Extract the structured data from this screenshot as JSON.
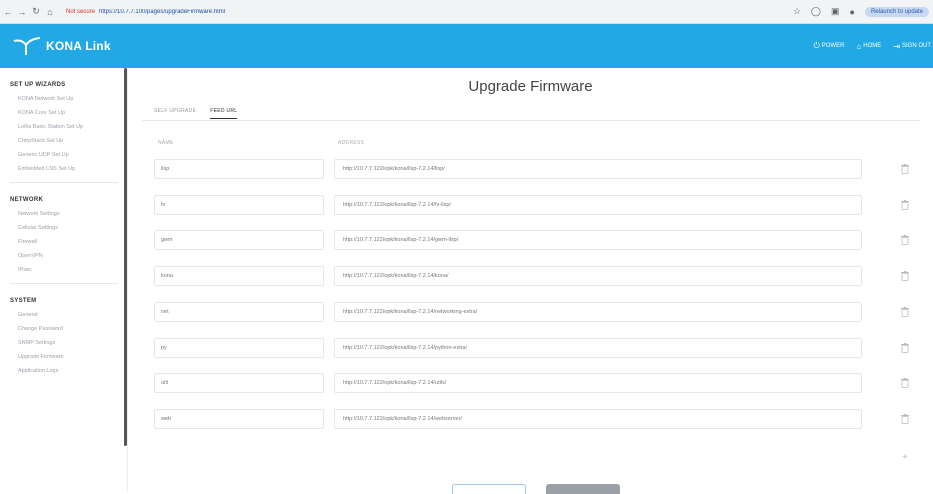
{
  "browser": {
    "not_secure_label": "Not secure",
    "url": "https://10.7.7.100/pages/upgradeFirmware.html",
    "update_label": "Relaunch to update"
  },
  "header": {
    "brand": "KONA Link",
    "links": [
      {
        "icon": "power-icon",
        "label": "POWER"
      },
      {
        "icon": "home-icon",
        "label": "HOME"
      },
      {
        "icon": "signout-icon",
        "label": "SIGN OUT"
      }
    ],
    "color": "#23a8e6"
  },
  "sidebar": {
    "sections": [
      {
        "title": "SET UP WIZARDS",
        "items": [
          "KONA Network Set Up",
          "KONA Core Set Up",
          "LoRa Basic Station Set Up",
          "ChirpStack Set Up",
          "Generic UDP Set Up",
          "Embedded LNS Set Up"
        ]
      },
      {
        "title": "NETWORK",
        "items": [
          "Network Settings",
          "Cellular Settings",
          "Firewall",
          "OpenVPN",
          "IPsec"
        ]
      },
      {
        "title": "SYSTEM",
        "items": [
          "General",
          "Change Password",
          "SNMP Settings",
          "Upgrade Firmware",
          "Application Logs"
        ]
      }
    ]
  },
  "main": {
    "title": "Upgrade Firmware",
    "tabs": [
      {
        "label": "SELF UPGRADE",
        "active": false
      },
      {
        "label": "FEED URL",
        "active": true
      }
    ],
    "columns": {
      "name": "NAME",
      "address": "ADDRESS"
    },
    "feeds": [
      {
        "name": "llsp",
        "address": "http://10.7.7.122/opk/kona/llsp-7.2.14/llsp/"
      },
      {
        "name": "fs",
        "address": "http://10.7.7.122/opk/kona/llsp-7.2.14/fs-llsp/"
      },
      {
        "name": "gwm",
        "address": "http://10.7.7.122/opk/kona/llsp-7.2.14/gwm-llsp/"
      },
      {
        "name": "kona",
        "address": "http://10.7.7.122/opk/kona/llsp-7.2.14/kona/"
      },
      {
        "name": "net",
        "address": "http://10.7.7.122/opk/kona/llsp-7.2.14/networking-extra/"
      },
      {
        "name": "py",
        "address": "http://10.7.7.122/opk/kona/llsp-7.2.14/python-extra/"
      },
      {
        "name": "util",
        "address": "http://10.7.7.122/opk/kona/llsp-7.2.14/utils/"
      },
      {
        "name": "web",
        "address": "http://10.7.7.122/opk/kona/llsp-7.2.14/webserver/"
      }
    ]
  }
}
